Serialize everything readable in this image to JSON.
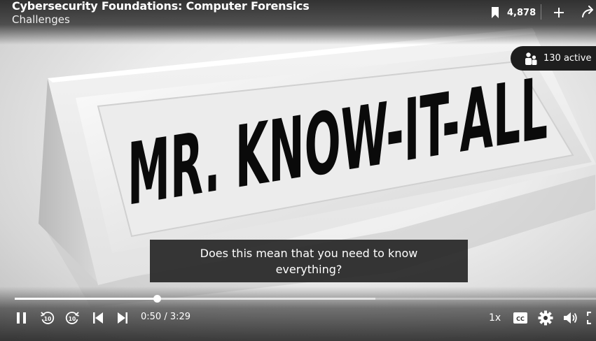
{
  "header": {
    "course_title": "Cybersecurity Foundations: Computer Forensics",
    "chapter_title": "Challenges",
    "bookmark_count": "4,878",
    "bookmark_icon": "bookmark-icon",
    "add_icon": "plus-icon",
    "share_icon": "share-icon"
  },
  "viewers": {
    "active_label": "130 active",
    "icon": "people-icon"
  },
  "video": {
    "sign_text": "MR. KNOW-IT-ALL",
    "caption": "Does this mean that you need to know everything?"
  },
  "player": {
    "time": "0:50 / 3:29",
    "played_fraction": 0.245,
    "buffered_fraction": 0.62,
    "speed": "1x",
    "icons": [
      "pause-icon",
      "rewind-10-icon",
      "forward-10-icon",
      "previous-icon",
      "next-icon",
      "closed-captions-icon",
      "settings-gear-icon",
      "volume-icon",
      "fullscreen-icon"
    ]
  }
}
